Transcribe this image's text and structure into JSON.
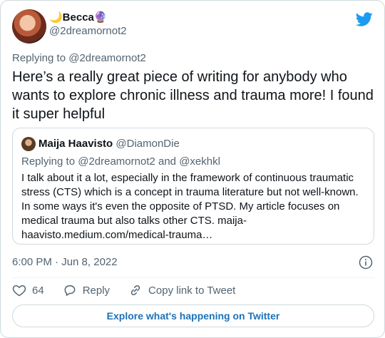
{
  "author": {
    "name": "🌙Becca🔮",
    "handle": "@2dreamornot2"
  },
  "tweet": {
    "replying_to_prefix": "Replying to ",
    "replying_to_handle": "@2dreamornot2",
    "text": "Here’s a really great piece of writing for anybody who wants to explore chronic illness and trauma more! I found it super helpful"
  },
  "quote": {
    "name": "Maija Haavisto",
    "handle": "@DiamonDie",
    "replying_text": "Replying to @2dreamornot2 and @xekhkl",
    "text": "I talk about it a lot, especially in the framework of continuous traumatic stress (CTS) which is a concept in trauma literature but not well-known. In some ways it's even the opposite of PTSD. My article focuses on medical trauma but also talks other CTS. maija-haavisto.medium.com/medical-trauma…"
  },
  "timestamp": "6:00 PM · Jun 8, 2022",
  "actions": {
    "like_count": "64",
    "reply_label": "Reply",
    "copy_link_label": "Copy link to Tweet"
  },
  "explore_label": "Explore what's happening on Twitter",
  "colors": {
    "brand": "#1d9bf0",
    "muted": "#536471",
    "border": "#cfd9de",
    "link": "#1d72b8"
  }
}
